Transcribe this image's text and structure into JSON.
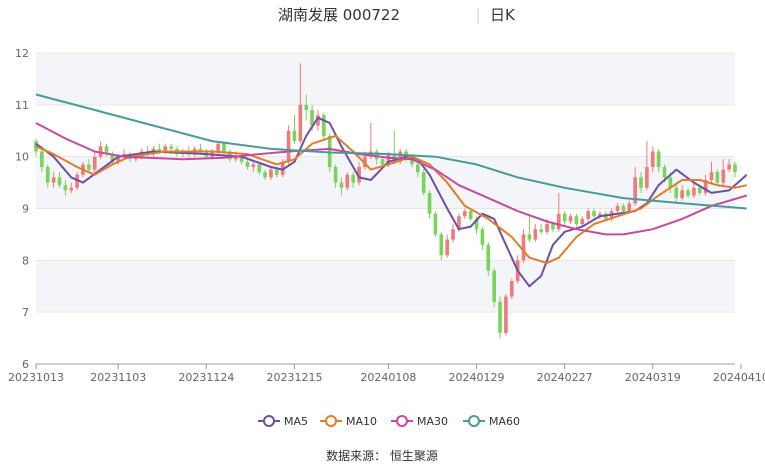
{
  "header": {
    "title": "湖南发展 000722",
    "period": "日K"
  },
  "source": "数据来源： 恒生聚源",
  "chart_data": {
    "type": "candlestick",
    "ylim": [
      6,
      12
    ],
    "y_ticks": [
      6,
      7,
      8,
      9,
      10,
      11,
      12
    ],
    "grid": "horizontal bands",
    "legend_position": "bottom",
    "x_ticks": [
      {
        "label": "20231013",
        "i": 0
      },
      {
        "label": "20231103",
        "i": 14
      },
      {
        "label": "20231124",
        "i": 29
      },
      {
        "label": "20231215",
        "i": 44
      },
      {
        "label": "20240108",
        "i": 60
      },
      {
        "label": "20240129",
        "i": 75
      },
      {
        "label": "20240227",
        "i": 90
      },
      {
        "label": "20240319",
        "i": 105
      },
      {
        "label": "20240410",
        "i": 120
      }
    ],
    "candles": [
      [
        10.3,
        10.1,
        10.35,
        10.0
      ],
      [
        10.1,
        9.8,
        10.2,
        9.7
      ],
      [
        9.8,
        9.5,
        9.85,
        9.4
      ],
      [
        9.5,
        9.6,
        9.7,
        9.4
      ],
      [
        9.6,
        9.45,
        9.7,
        9.4
      ],
      [
        9.45,
        9.35,
        9.55,
        9.25
      ],
      [
        9.35,
        9.4,
        9.5,
        9.3
      ],
      [
        9.4,
        9.65,
        9.7,
        9.35
      ],
      [
        9.65,
        9.85,
        9.9,
        9.6
      ],
      [
        9.85,
        9.75,
        9.95,
        9.7
      ],
      [
        9.75,
        10.0,
        10.1,
        9.7
      ],
      [
        10.0,
        10.2,
        10.3,
        9.95
      ],
      [
        10.2,
        10.05,
        10.25,
        10.0
      ],
      [
        10.05,
        9.9,
        10.1,
        9.85
      ],
      [
        9.9,
        10.0,
        10.05,
        9.85
      ],
      [
        10.0,
        10.05,
        10.15,
        9.95
      ],
      [
        10.05,
        9.95,
        10.1,
        9.9
      ],
      [
        9.95,
        10.0,
        10.05,
        9.9
      ],
      [
        10.0,
        10.1,
        10.15,
        9.95
      ],
      [
        10.1,
        10.05,
        10.2,
        10.0
      ],
      [
        10.05,
        10.15,
        10.2,
        10.0
      ],
      [
        10.15,
        10.1,
        10.25,
        10.05
      ],
      [
        10.1,
        10.2,
        10.25,
        10.05
      ],
      [
        10.2,
        10.15,
        10.25,
        10.05
      ],
      [
        10.15,
        10.05,
        10.2,
        10.0
      ],
      [
        10.05,
        10.1,
        10.15,
        10.0
      ],
      [
        10.1,
        10.05,
        10.2,
        10.0
      ],
      [
        10.05,
        10.15,
        10.2,
        10.0
      ],
      [
        10.15,
        10.1,
        10.25,
        10.05
      ],
      [
        10.1,
        10.0,
        10.15,
        9.95
      ],
      [
        10.0,
        10.1,
        10.15,
        9.95
      ],
      [
        10.1,
        10.25,
        10.3,
        10.05
      ],
      [
        10.25,
        10.1,
        10.3,
        10.05
      ],
      [
        10.1,
        9.95,
        10.15,
        9.9
      ],
      [
        9.95,
        10.0,
        10.1,
        9.9
      ],
      [
        10.0,
        9.9,
        10.05,
        9.85
      ],
      [
        9.9,
        9.8,
        9.95,
        9.75
      ],
      [
        9.8,
        9.85,
        9.9,
        9.7
      ],
      [
        9.85,
        9.7,
        9.9,
        9.65
      ],
      [
        9.7,
        9.6,
        9.75,
        9.55
      ],
      [
        9.6,
        9.75,
        9.8,
        9.55
      ],
      [
        9.75,
        9.65,
        9.8,
        9.6
      ],
      [
        9.65,
        9.9,
        9.95,
        9.6
      ],
      [
        9.9,
        10.5,
        10.6,
        9.85
      ],
      [
        10.5,
        10.3,
        10.8,
        10.25
      ],
      [
        10.3,
        11.0,
        11.8,
        10.25
      ],
      [
        11.0,
        10.9,
        11.2,
        10.7
      ],
      [
        10.9,
        10.6,
        11.0,
        10.5
      ],
      [
        10.6,
        10.8,
        10.9,
        10.5
      ],
      [
        10.8,
        10.4,
        10.85,
        10.3
      ],
      [
        10.4,
        9.8,
        10.45,
        9.7
      ],
      [
        9.8,
        9.5,
        9.85,
        9.4
      ],
      [
        9.5,
        9.4,
        9.6,
        9.25
      ],
      [
        9.4,
        9.65,
        9.7,
        9.35
      ],
      [
        9.65,
        9.5,
        9.7,
        9.4
      ],
      [
        9.5,
        9.8,
        9.9,
        9.45
      ],
      [
        9.8,
        10.0,
        10.1,
        9.75
      ],
      [
        10.0,
        10.1,
        10.65,
        9.95
      ],
      [
        10.1,
        9.95,
        10.15,
        9.85
      ],
      [
        9.95,
        9.85,
        10.0,
        9.8
      ],
      [
        9.85,
        10.05,
        10.1,
        9.8
      ],
      [
        10.05,
        9.9,
        10.5,
        9.85
      ],
      [
        9.9,
        10.1,
        10.15,
        9.85
      ],
      [
        10.1,
        9.95,
        10.15,
        9.9
      ],
      [
        9.95,
        9.85,
        10.0,
        9.8
      ],
      [
        9.85,
        9.7,
        9.9,
        9.6
      ],
      [
        9.7,
        9.3,
        9.75,
        9.25
      ],
      [
        9.3,
        8.9,
        9.35,
        8.8
      ],
      [
        8.9,
        8.5,
        8.95,
        8.45
      ],
      [
        8.5,
        8.1,
        8.55,
        8.0
      ],
      [
        8.1,
        8.4,
        8.5,
        8.05
      ],
      [
        8.4,
        8.6,
        8.7,
        8.35
      ],
      [
        8.6,
        8.85,
        8.9,
        8.55
      ],
      [
        8.85,
        8.95,
        9.0,
        8.8
      ],
      [
        8.95,
        8.8,
        9.0,
        8.75
      ],
      [
        8.8,
        8.6,
        8.85,
        8.5
      ],
      [
        8.6,
        8.3,
        8.65,
        8.2
      ],
      [
        8.3,
        7.8,
        8.35,
        7.7
      ],
      [
        7.8,
        7.2,
        7.85,
        7.1
      ],
      [
        7.2,
        6.6,
        7.3,
        6.5
      ],
      [
        6.6,
        7.3,
        7.35,
        6.55
      ],
      [
        7.3,
        7.6,
        7.65,
        7.25
      ],
      [
        7.6,
        8.0,
        8.1,
        7.55
      ],
      [
        8.0,
        8.5,
        8.6,
        7.95
      ],
      [
        8.5,
        8.4,
        8.9,
        8.35
      ],
      [
        8.4,
        8.6,
        8.7,
        8.35
      ],
      [
        8.6,
        8.55,
        8.7,
        8.5
      ],
      [
        8.55,
        8.7,
        8.8,
        8.5
      ],
      [
        8.7,
        8.6,
        8.75,
        8.55
      ],
      [
        8.6,
        8.9,
        9.3,
        8.55
      ],
      [
        8.9,
        8.75,
        8.95,
        8.65
      ],
      [
        8.75,
        8.85,
        8.9,
        8.7
      ],
      [
        8.85,
        8.7,
        8.9,
        8.65
      ],
      [
        8.7,
        8.8,
        8.85,
        8.65
      ],
      [
        8.8,
        8.95,
        9.0,
        8.75
      ],
      [
        8.95,
        8.85,
        9.0,
        8.8
      ],
      [
        8.85,
        8.9,
        8.95,
        8.8
      ],
      [
        8.9,
        8.8,
        8.95,
        8.75
      ],
      [
        8.8,
        8.95,
        9.0,
        8.75
      ],
      [
        8.95,
        9.05,
        9.1,
        8.9
      ],
      [
        9.05,
        8.95,
        9.1,
        8.9
      ],
      [
        8.95,
        9.1,
        9.15,
        8.9
      ],
      [
        9.1,
        9.6,
        9.8,
        9.05
      ],
      [
        9.6,
        9.4,
        9.7,
        9.3
      ],
      [
        9.4,
        9.8,
        10.3,
        9.35
      ],
      [
        9.8,
        10.1,
        10.2,
        9.7
      ],
      [
        10.1,
        9.8,
        10.15,
        9.7
      ],
      [
        9.8,
        9.6,
        9.85,
        9.5
      ],
      [
        9.6,
        9.4,
        9.7,
        9.3
      ],
      [
        9.4,
        9.2,
        9.5,
        9.1
      ],
      [
        9.2,
        9.35,
        9.45,
        9.15
      ],
      [
        9.35,
        9.25,
        9.4,
        9.2
      ],
      [
        9.25,
        9.4,
        9.5,
        9.2
      ],
      [
        9.4,
        9.3,
        9.45,
        9.25
      ],
      [
        9.3,
        9.55,
        9.65,
        9.25
      ],
      [
        9.55,
        9.7,
        9.9,
        9.5
      ],
      [
        9.7,
        9.5,
        9.75,
        9.45
      ],
      [
        9.5,
        9.75,
        9.95,
        9.45
      ],
      [
        9.75,
        9.85,
        9.95,
        9.7
      ],
      [
        9.85,
        9.7,
        9.9,
        9.6
      ]
    ],
    "series": [
      {
        "name": "MA5",
        "color": "#6e4fa8",
        "points": [
          [
            0,
            10.25
          ],
          [
            3,
            10.0
          ],
          [
            6,
            9.6
          ],
          [
            8,
            9.5
          ],
          [
            11,
            9.75
          ],
          [
            14,
            10.0
          ],
          [
            20,
            10.1
          ],
          [
            29,
            10.05
          ],
          [
            35,
            10.0
          ],
          [
            40,
            9.8
          ],
          [
            42,
            9.75
          ],
          [
            44,
            9.9
          ],
          [
            46,
            10.4
          ],
          [
            48,
            10.75
          ],
          [
            50,
            10.65
          ],
          [
            52,
            10.2
          ],
          [
            55,
            9.6
          ],
          [
            57,
            9.55
          ],
          [
            60,
            9.9
          ],
          [
            63,
            10.0
          ],
          [
            65,
            9.95
          ],
          [
            67,
            9.65
          ],
          [
            70,
            9.0
          ],
          [
            72,
            8.6
          ],
          [
            74,
            8.65
          ],
          [
            76,
            8.9
          ],
          [
            78,
            8.8
          ],
          [
            80,
            8.3
          ],
          [
            82,
            7.8
          ],
          [
            84,
            7.5
          ],
          [
            86,
            7.7
          ],
          [
            88,
            8.3
          ],
          [
            90,
            8.55
          ],
          [
            93,
            8.65
          ],
          [
            96,
            8.85
          ],
          [
            99,
            8.9
          ],
          [
            102,
            8.95
          ],
          [
            104,
            9.1
          ],
          [
            106,
            9.45
          ],
          [
            109,
            9.75
          ],
          [
            112,
            9.5
          ],
          [
            115,
            9.3
          ],
          [
            118,
            9.35
          ],
          [
            120,
            9.55
          ],
          [
            121,
            9.65
          ]
        ]
      },
      {
        "name": "MA10",
        "color": "#e07d2a",
        "points": [
          [
            0,
            10.2
          ],
          [
            3,
            10.05
          ],
          [
            7,
            9.8
          ],
          [
            10,
            9.65
          ],
          [
            13,
            9.85
          ],
          [
            16,
            10.0
          ],
          [
            22,
            10.1
          ],
          [
            30,
            10.1
          ],
          [
            36,
            10.05
          ],
          [
            41,
            9.85
          ],
          [
            44,
            9.95
          ],
          [
            47,
            10.25
          ],
          [
            51,
            10.4
          ],
          [
            54,
            10.1
          ],
          [
            57,
            9.75
          ],
          [
            60,
            9.85
          ],
          [
            64,
            10.0
          ],
          [
            67,
            9.85
          ],
          [
            70,
            9.5
          ],
          [
            73,
            9.05
          ],
          [
            77,
            8.8
          ],
          [
            81,
            8.45
          ],
          [
            84,
            8.05
          ],
          [
            87,
            7.95
          ],
          [
            89,
            8.05
          ],
          [
            92,
            8.45
          ],
          [
            95,
            8.7
          ],
          [
            99,
            8.85
          ],
          [
            103,
            9.0
          ],
          [
            106,
            9.25
          ],
          [
            110,
            9.55
          ],
          [
            113,
            9.55
          ],
          [
            116,
            9.45
          ],
          [
            119,
            9.4
          ],
          [
            121,
            9.45
          ]
        ]
      },
      {
        "name": "MA30",
        "color": "#c84aa0",
        "points": [
          [
            0,
            10.65
          ],
          [
            5,
            10.35
          ],
          [
            10,
            10.1
          ],
          [
            15,
            10.0
          ],
          [
            25,
            9.95
          ],
          [
            32,
            9.98
          ],
          [
            38,
            10.05
          ],
          [
            43,
            10.1
          ],
          [
            50,
            10.15
          ],
          [
            55,
            10.05
          ],
          [
            60,
            9.98
          ],
          [
            64,
            9.95
          ],
          [
            68,
            9.75
          ],
          [
            72,
            9.45
          ],
          [
            77,
            9.2
          ],
          [
            82,
            8.95
          ],
          [
            87,
            8.75
          ],
          [
            92,
            8.6
          ],
          [
            97,
            8.5
          ],
          [
            100,
            8.5
          ],
          [
            105,
            8.6
          ],
          [
            110,
            8.8
          ],
          [
            115,
            9.05
          ],
          [
            121,
            9.25
          ]
        ]
      },
      {
        "name": "MA60",
        "color": "#4a9a9a",
        "points": [
          [
            0,
            11.2
          ],
          [
            10,
            10.9
          ],
          [
            20,
            10.6
          ],
          [
            30,
            10.3
          ],
          [
            40,
            10.15
          ],
          [
            50,
            10.08
          ],
          [
            60,
            10.05
          ],
          [
            68,
            10.0
          ],
          [
            75,
            9.85
          ],
          [
            82,
            9.6
          ],
          [
            90,
            9.4
          ],
          [
            100,
            9.2
          ],
          [
            110,
            9.1
          ],
          [
            121,
            9.0
          ]
        ]
      }
    ]
  }
}
